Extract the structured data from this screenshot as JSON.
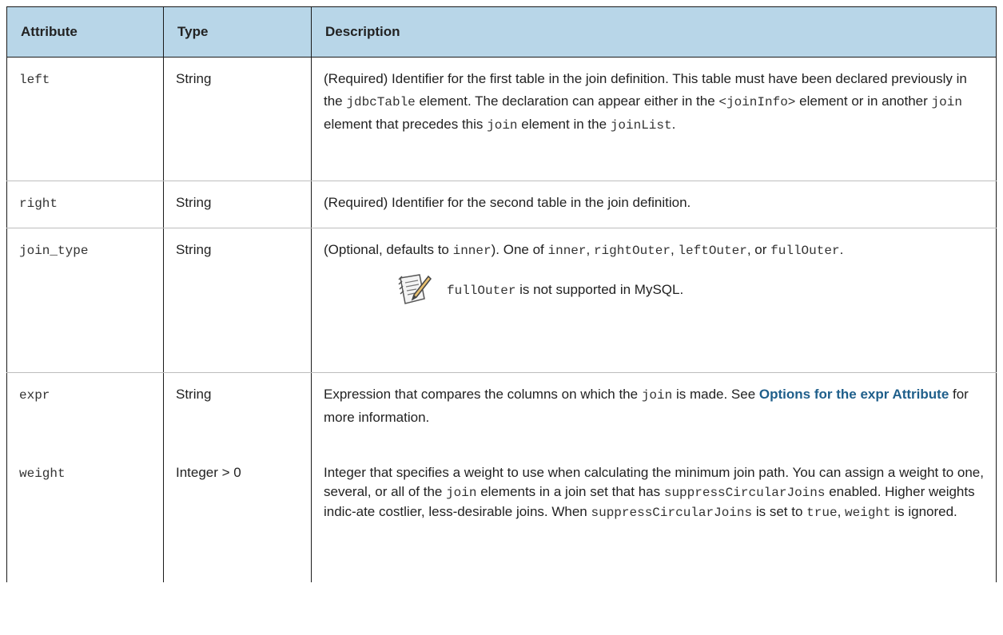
{
  "table": {
    "headers": {
      "attribute": "Attribute",
      "type": "Type",
      "description": "Description"
    },
    "rows": {
      "left": {
        "attribute": "left",
        "type": "String",
        "d1": "(Required) Identifier for the first table in the join definition. This table must have been declared previously in the ",
        "c1": "jdbcTable",
        "d2": " element. The declaration can appear either in the ",
        "c2": "<joinInfo>",
        "d3": " element or in another ",
        "c3": "join",
        "d4": " element that precedes this ",
        "c4": "join",
        "d5": " element in the ",
        "c5": "joinList",
        "d6": "."
      },
      "right": {
        "attribute": "right",
        "type": "String",
        "d1": "(Required) Identifier for the second table in the join definition."
      },
      "join_type": {
        "attribute": "join_type",
        "type": "String",
        "d1": "(Optional, defaults to ",
        "c1": "inner",
        "d2": "). One of ",
        "c2": "inner",
        "d3": ", ",
        "c3": "rightOuter",
        "d4": ", ",
        "c4": "leftOuter",
        "d5": ", or ",
        "c5": "fullOuter",
        "d6": ".",
        "note_code": "fullOuter",
        "note_text": " is not supported in MySQL.",
        "note_icon": "note-pencil-icon"
      },
      "expr": {
        "attribute": "expr",
        "type": "String",
        "d1": "Expression that compares the columns on which the ",
        "c1": "join",
        "d2": " is made. See ",
        "link": "Options for the expr Attribute",
        "d3": " for more information."
      },
      "weight": {
        "attribute": "weight",
        "type": "Integer > 0",
        "d1": "Integer that specifies a weight to use when calculating the minimum join path. You can assign a weight to one, several, or all of the ",
        "c1": "join",
        "d2": " elements in a join set that has ",
        "c2": "suppressCircularJoins",
        "d3": " enabled. Higher weights indic-ate costlier, less-desirable joins. When ",
        "c3": "suppressCircularJoins",
        "d4": " is set to ",
        "c4": "true",
        "d5": ", ",
        "c5": "weight",
        "d6": " is ignored."
      }
    }
  },
  "colors": {
    "header_bg": "#b8d6e8",
    "link": "#1f5f8b"
  }
}
